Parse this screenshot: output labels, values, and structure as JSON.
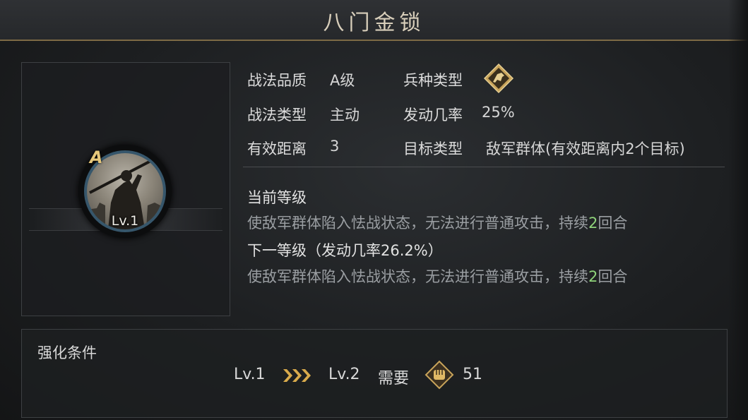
{
  "header": {
    "title": "八门金锁"
  },
  "portrait": {
    "grade": "A",
    "level": "Lv.1"
  },
  "stats": {
    "quality_label": "战法品质",
    "quality_value": "A级",
    "troop_label": "兵种类型",
    "troop_icon": "cavalry-horse-icon",
    "type_label": "战法类型",
    "type_value": "主动",
    "trigger_label": "发动几率",
    "trigger_value": "25%",
    "range_label": "有效距离",
    "range_value": "3",
    "target_label": "目标类型",
    "target_value": "敌军群体(有效距离内2个目标)"
  },
  "current_level": {
    "heading": "当前等级",
    "desc_prefix": "使敌军群体陷入怯战状态，无法进行普通攻击，持续",
    "desc_highlight": "2",
    "desc_suffix": "回合"
  },
  "next_level": {
    "heading": "下一等级（发动几率26.2%）",
    "desc_prefix": "使敌军群体陷入怯战状态，无法进行普通攻击，持续",
    "desc_highlight": "2",
    "desc_suffix": "回合"
  },
  "upgrade": {
    "title": "强化条件",
    "from_level": "Lv.1",
    "arrow_icon": "triple-chevron-right-icon",
    "to_level": "Lv.2",
    "need_label": "需要",
    "resource_icon": "fist-token-icon",
    "resource_amount": "51"
  },
  "colors": {
    "highlight_green": "#8fd37a",
    "gold": "#c9a45a"
  }
}
